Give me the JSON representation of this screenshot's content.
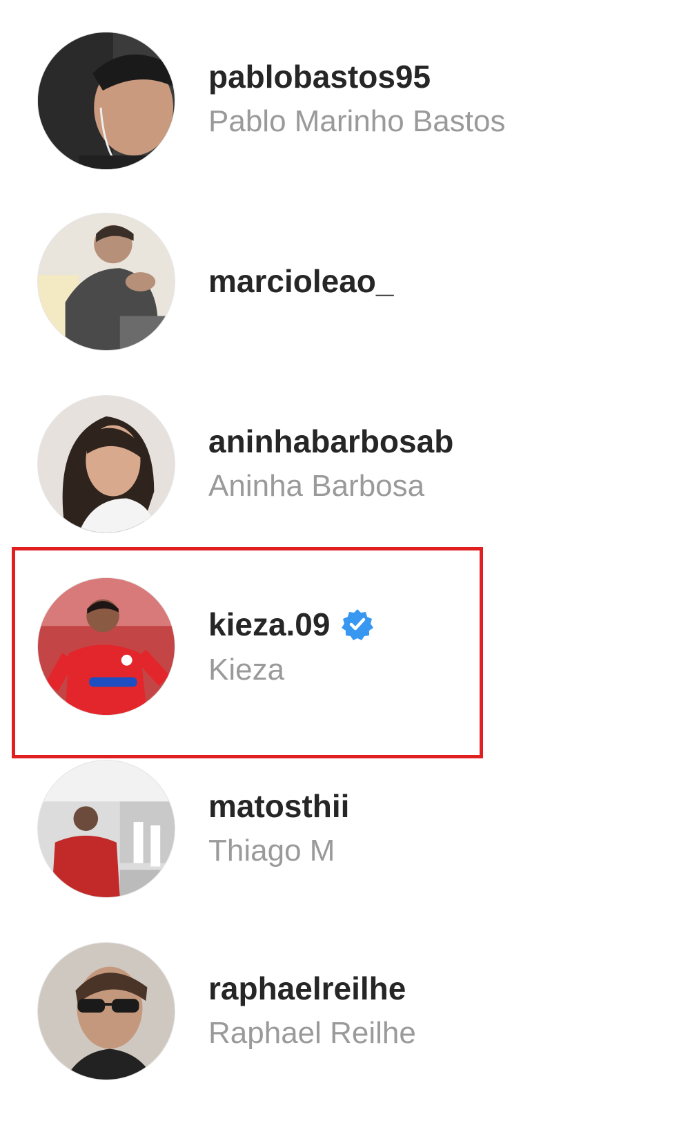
{
  "accounts": [
    {
      "username": "pablobastos95",
      "full_name": "Pablo Marinho Bastos",
      "verified": false
    },
    {
      "username": "marcioleao_",
      "full_name": "",
      "verified": false
    },
    {
      "username": "aninhabarbosab",
      "full_name": "Aninha Barbosa",
      "verified": false
    },
    {
      "username": "kieza.09",
      "full_name": "Kieza",
      "verified": true
    },
    {
      "username": "matosthii",
      "full_name": "Thiago M",
      "verified": false
    },
    {
      "username": "raphaelreilhe",
      "full_name": "Raphael Reilhe",
      "verified": false
    }
  ],
  "highlighted_account": "kieza.09",
  "colors": {
    "username_text": "#262626",
    "full_name_text": "#9a9a9a",
    "highlight_border": "#e02020",
    "verified_badge": "#3897f0"
  },
  "icons": {
    "verified": "verified-badge-icon"
  }
}
